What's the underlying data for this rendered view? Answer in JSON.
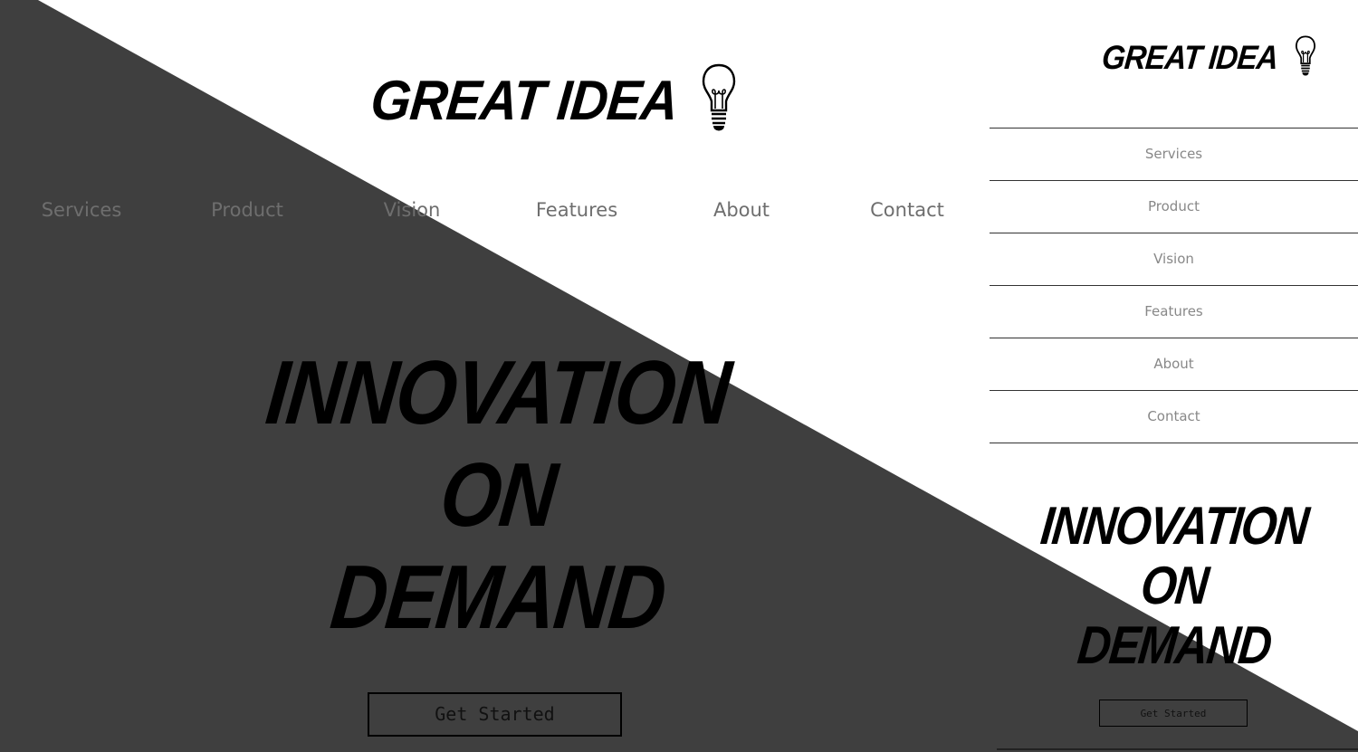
{
  "brand": {
    "name": "GREAT IDEA",
    "icon": "lightbulb-icon"
  },
  "nav": {
    "items": [
      {
        "label": "Services"
      },
      {
        "label": "Product"
      },
      {
        "label": "Vision"
      },
      {
        "label": "Features"
      },
      {
        "label": "About"
      },
      {
        "label": "Contact"
      }
    ]
  },
  "hero": {
    "line1": "INNOVATION",
    "line2": "ON",
    "line3": "DEMAND",
    "cta_label": "Get Started"
  },
  "colors": {
    "backdrop_dark": "#3f3f3f",
    "page_light": "#ffffff",
    "text_dark": "#000000",
    "nav_text": "#6e6e6e"
  }
}
